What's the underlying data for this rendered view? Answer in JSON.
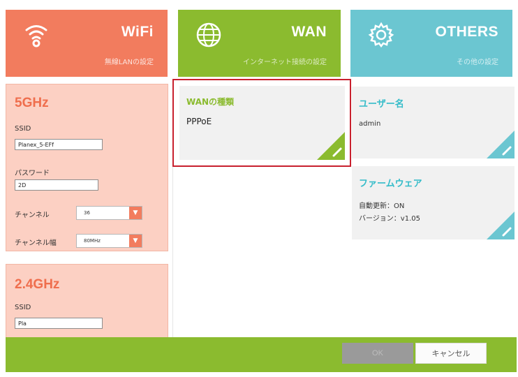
{
  "tabs": {
    "wifi": {
      "title": "WiFi",
      "subtitle": "無線LANの設定"
    },
    "wan": {
      "title": "WAN",
      "subtitle": "インターネット接続の設定"
    },
    "others": {
      "title": "OTHERS",
      "subtitle": "その他の設定"
    }
  },
  "wifi5": {
    "title": "5GHz",
    "ssid_label": "SSID",
    "ssid_value": "Planex_5-EFf",
    "password_label": "パスワード",
    "password_value": "2D",
    "channel_label": "チャンネル",
    "channel_value": "36",
    "width_label": "チャンネル幅",
    "width_value": "80MHz"
  },
  "wifi24": {
    "title": "2.4GHz",
    "ssid_label": "SSID",
    "ssid_value": "Pla"
  },
  "wan_card": {
    "title": "WANの種類",
    "value": "PPPoE"
  },
  "user_card": {
    "title": "ユーザー名",
    "value": "admin"
  },
  "fw_card": {
    "title": "ファームウェア",
    "auto_update": "自動更新：ON",
    "version": "バージョン：v1.05"
  },
  "footer": {
    "ok_label": "OK",
    "cancel_label": "キャンセル"
  },
  "colors": {
    "wifi": "#f27c5e",
    "wan": "#8bbb2f",
    "others": "#6bc6d1",
    "highlight": "#c8202e"
  }
}
